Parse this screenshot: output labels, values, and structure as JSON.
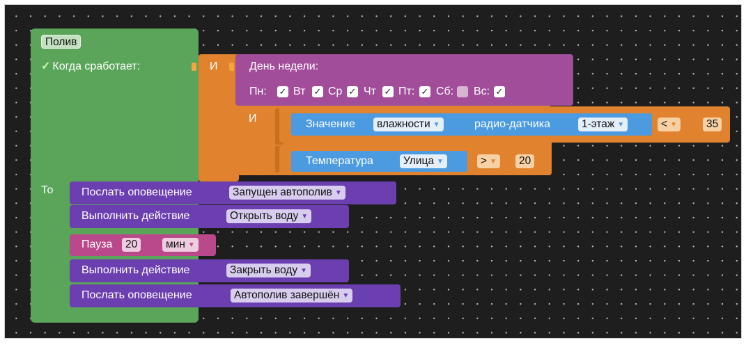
{
  "colors": {
    "workspace_bg": "#1e1e1e",
    "green_block": "#5ba55b",
    "orange_block": "#e0822e",
    "magenta_block": "#a24d9a",
    "purple_block": "#6c3fb0",
    "blue_block": "#4c9be0",
    "pink_block": "#b9498a"
  },
  "rule": {
    "name": "Полив",
    "when_label": "Когда сработает:",
    "then_label": "То"
  },
  "and_outer": "И",
  "and_inner": "И",
  "weekday": {
    "title": "День недели:",
    "days": [
      {
        "label": "Пн:",
        "checked": true
      },
      {
        "label": "Вт",
        "checked": true
      },
      {
        "label": "Ср",
        "checked": true
      },
      {
        "label": "Чт",
        "checked": true
      },
      {
        "label": "Пт:",
        "checked": true
      },
      {
        "label": "Сб:",
        "checked": false
      },
      {
        "label": "Вс:",
        "checked": true
      }
    ]
  },
  "sensor": {
    "label": "Значение",
    "measure": "влажности",
    "mid": "радио-датчика",
    "device": "1-этаж",
    "op": "<",
    "value": "35"
  },
  "temp": {
    "label": "Температура",
    "place": "Улица",
    "op": ">",
    "value": "20"
  },
  "actions": [
    {
      "label": "Послать оповещение",
      "value": "Запущен автополив"
    },
    {
      "label": "Выполнить действие",
      "value": "Открыть воду"
    },
    {
      "label": "Пауза",
      "value": "20",
      "unit": "мин"
    },
    {
      "label": "Выполнить действие",
      "value": "Закрыть воду"
    },
    {
      "label": "Послать оповещение",
      "value": "Автополив завершён"
    }
  ]
}
